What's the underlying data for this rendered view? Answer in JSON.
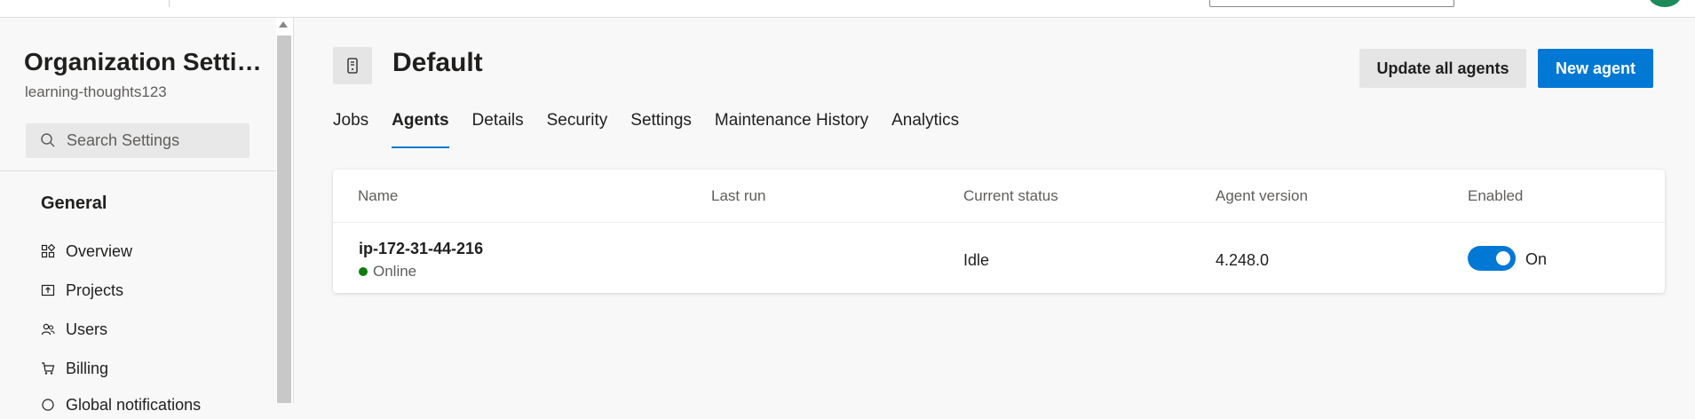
{
  "sidebar": {
    "title": "Organization Settings",
    "org": "learning-thoughts123",
    "search_placeholder": "Search Settings",
    "section": "General",
    "items": [
      {
        "label": "Overview",
        "icon": "overview-icon"
      },
      {
        "label": "Projects",
        "icon": "projects-icon"
      },
      {
        "label": "Users",
        "icon": "users-icon"
      },
      {
        "label": "Billing",
        "icon": "billing-icon"
      },
      {
        "label": "Global notifications",
        "icon": "notifications-icon"
      }
    ]
  },
  "pool": {
    "title": "Default",
    "icon": "agent-pool-icon"
  },
  "actions": {
    "update_all": "Update all agents",
    "new_agent": "New agent"
  },
  "tabs": [
    {
      "label": "Jobs",
      "active": false
    },
    {
      "label": "Agents",
      "active": true
    },
    {
      "label": "Details",
      "active": false
    },
    {
      "label": "Security",
      "active": false
    },
    {
      "label": "Settings",
      "active": false
    },
    {
      "label": "Maintenance History",
      "active": false
    },
    {
      "label": "Analytics",
      "active": false
    }
  ],
  "table": {
    "columns": [
      "Name",
      "Last run",
      "Current status",
      "Agent version",
      "Enabled"
    ],
    "rows": [
      {
        "name": "ip-172-31-44-216",
        "online_status": "Online",
        "last_run": "",
        "current_status": "Idle",
        "agent_version": "4.248.0",
        "enabled": true,
        "enabled_label": "On"
      }
    ]
  },
  "colors": {
    "accent": "#0078d4",
    "online": "#107c10"
  }
}
